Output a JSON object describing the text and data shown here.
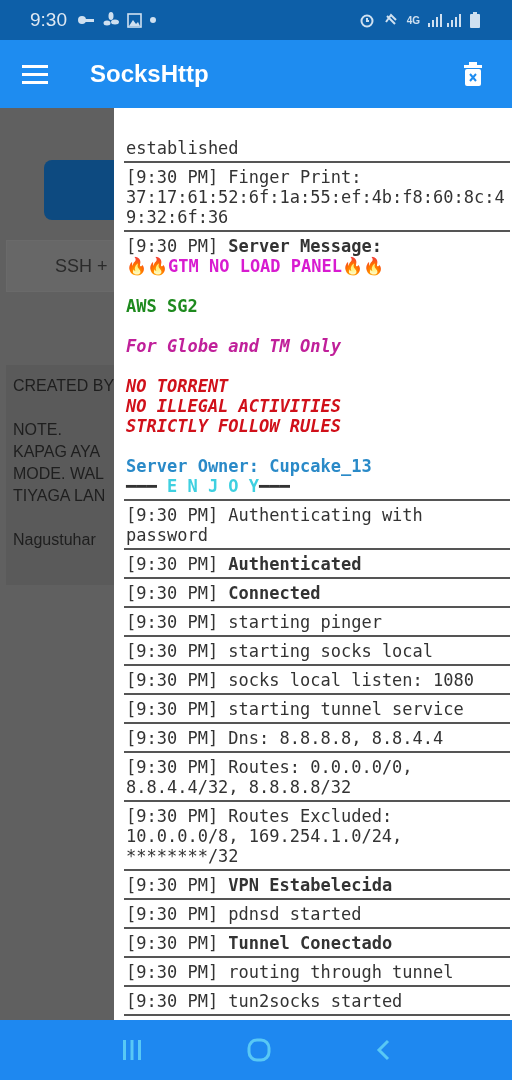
{
  "status_bar": {
    "time": "9:30",
    "network": "4G"
  },
  "app_bar": {
    "title": "SocksHttp"
  },
  "background": {
    "field_placeholder": "SSH +",
    "card_groups": [
      [
        "CREATED BY"
      ],
      [
        "NOTE.",
        "KAPAG AYA",
        "MODE. WAL",
        "TIYAGA LAN"
      ],
      [
        "Nagustuhar"
      ]
    ]
  },
  "log": [
    {
      "kind": "plain",
      "text": "established",
      "bold": false
    },
    {
      "kind": "plain",
      "time": "[9:30 PM]",
      "text": "Finger Print: 37:17:61:52:6f:1a:55:ef:4b:f8:60:8c:49:32:6f:36",
      "bold": false
    },
    {
      "kind": "message",
      "time": "[9:30 PM]",
      "text": "Server Message:",
      "bold": true,
      "paragraphs": [
        [
          {
            "italic": false,
            "segments": [
              {
                "text": "🔥🔥GTM NO LOAD PANEL🔥🔥",
                "color": "#d81bd0"
              }
            ]
          }
        ],
        [
          {
            "italic": false,
            "segments": [
              {
                "text": "AWS SG2",
                "color": "#1e8a1e"
              }
            ]
          }
        ],
        [
          {
            "italic": true,
            "segments": [
              {
                "text": "For Globe and TM Only",
                "color": "#c0209a"
              }
            ]
          }
        ],
        [
          {
            "italic": true,
            "segments": [
              {
                "text": "NO TORRENT",
                "color": "#d0101a"
              }
            ]
          },
          {
            "italic": true,
            "segments": [
              {
                "text": "NO ILLEGAL ACTIVITIES",
                "color": "#d0101a"
              }
            ]
          },
          {
            "italic": true,
            "segments": [
              {
                "text": "STRICTLY FOLLOW RULES",
                "color": "#d0101a"
              }
            ]
          }
        ],
        [
          {
            "italic": false,
            "segments": [
              {
                "text": "Server Owner: Cupcake_13",
                "color": "#2a8ac8"
              }
            ]
          },
          {
            "italic": false,
            "segments": [
              {
                "text": "━━━",
                "color": "#333333"
              },
              {
                "text": " E N J O Y",
                "color": "#3fd0e0"
              },
              {
                "text": "━━━",
                "color": "#333333"
              }
            ]
          }
        ]
      ]
    },
    {
      "kind": "plain",
      "time": "[9:30 PM]",
      "text": "Authenticating with password",
      "bold": false
    },
    {
      "kind": "plain",
      "time": "[9:30 PM]",
      "text": "Authenticated",
      "bold": true
    },
    {
      "kind": "plain",
      "time": "[9:30 PM]",
      "text": "Connected",
      "bold": true
    },
    {
      "kind": "plain",
      "time": "[9:30 PM]",
      "text": "starting pinger",
      "bold": false
    },
    {
      "kind": "plain",
      "time": "[9:30 PM]",
      "text": "starting socks local",
      "bold": false
    },
    {
      "kind": "plain",
      "time": "[9:30 PM]",
      "text": "socks local listen: 1080",
      "bold": false
    },
    {
      "kind": "plain",
      "time": "[9:30 PM]",
      "text": "starting tunnel service",
      "bold": false
    },
    {
      "kind": "plain",
      "time": "[9:30 PM]",
      "text": "Dns: 8.8.8.8, 8.8.4.4",
      "bold": false
    },
    {
      "kind": "plain",
      "time": "[9:30 PM]",
      "text": "Routes: 0.0.0.0/0, 8.8.4.4/32, 8.8.8.8/32",
      "bold": false
    },
    {
      "kind": "plain",
      "time": "[9:30 PM]",
      "text": "Routes Excluded: 10.0.0.0/8, 169.254.1.0/24, ********/32",
      "bold": false
    },
    {
      "kind": "plain",
      "time": "[9:30 PM]",
      "text": "VPN Estabelecida",
      "bold": true
    },
    {
      "kind": "plain",
      "time": "[9:30 PM]",
      "text": "pdnsd started",
      "bold": false
    },
    {
      "kind": "plain",
      "time": "[9:30 PM]",
      "text": "Tunnel Conectado",
      "bold": true
    },
    {
      "kind": "plain",
      "time": "[9:30 PM]",
      "text": "routing through tunnel",
      "bold": false
    },
    {
      "kind": "plain",
      "time": "[9:30 PM]",
      "text": "tun2socks started",
      "bold": false
    }
  ]
}
